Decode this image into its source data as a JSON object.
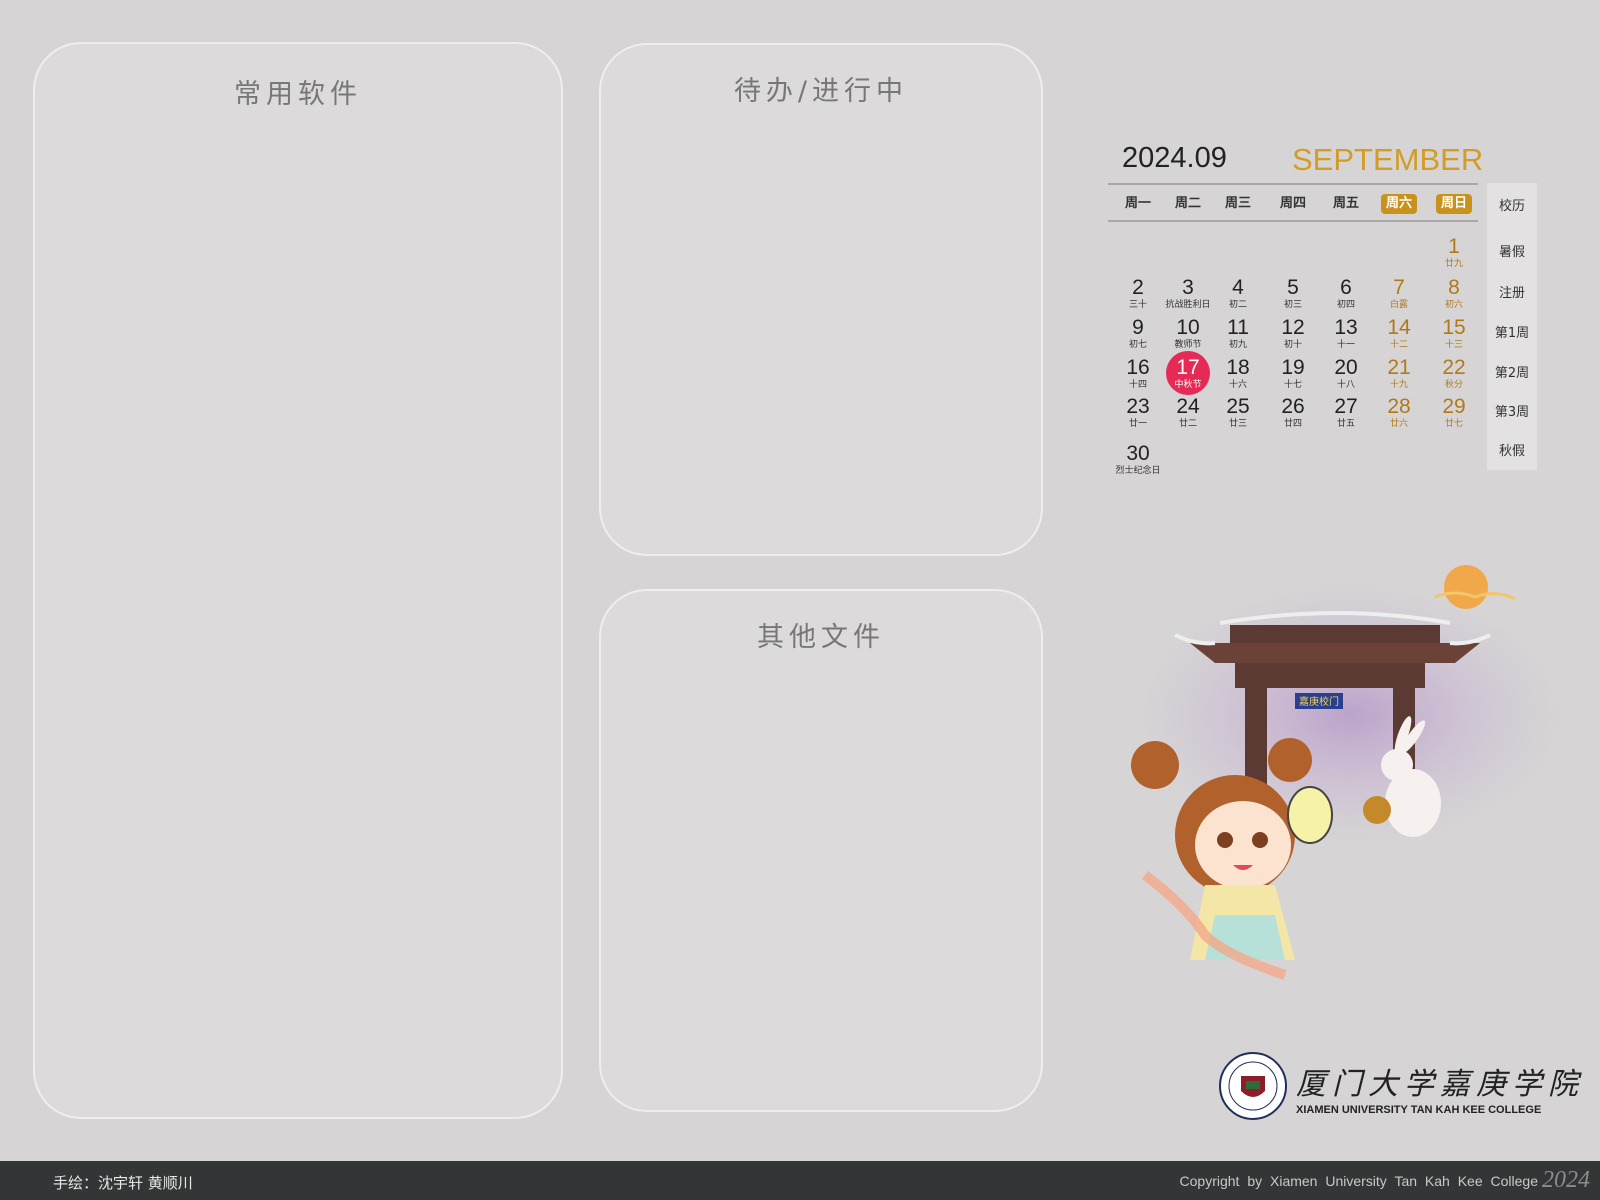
{
  "panels": {
    "software_title": "常用软件",
    "todo_title": "待办/进行中",
    "other_title": "其他文件"
  },
  "calendar": {
    "year_month": "2024.09",
    "month_name": "SEPTEMBER",
    "weekdays": [
      "周一",
      "周二",
      "周三",
      "周四",
      "周五",
      "周六",
      "周日"
    ],
    "today": 17,
    "days": [
      {
        "n": "1",
        "s": "廿九"
      },
      {
        "n": "2",
        "s": "三十"
      },
      {
        "n": "3",
        "s": "抗战胜利日"
      },
      {
        "n": "4",
        "s": "初二"
      },
      {
        "n": "5",
        "s": "初三"
      },
      {
        "n": "6",
        "s": "初四"
      },
      {
        "n": "7",
        "s": "白露"
      },
      {
        "n": "8",
        "s": "初六"
      },
      {
        "n": "9",
        "s": "初七"
      },
      {
        "n": "10",
        "s": "教师节"
      },
      {
        "n": "11",
        "s": "初九"
      },
      {
        "n": "12",
        "s": "初十"
      },
      {
        "n": "13",
        "s": "十一"
      },
      {
        "n": "14",
        "s": "十二"
      },
      {
        "n": "15",
        "s": "十三"
      },
      {
        "n": "16",
        "s": "十四"
      },
      {
        "n": "17",
        "s": "中秋节"
      },
      {
        "n": "18",
        "s": "十六"
      },
      {
        "n": "19",
        "s": "十七"
      },
      {
        "n": "20",
        "s": "十八"
      },
      {
        "n": "21",
        "s": "十九"
      },
      {
        "n": "22",
        "s": "秋分"
      },
      {
        "n": "23",
        "s": "廿一"
      },
      {
        "n": "24",
        "s": "廿二"
      },
      {
        "n": "25",
        "s": "廿三"
      },
      {
        "n": "26",
        "s": "廿四"
      },
      {
        "n": "27",
        "s": "廿五"
      },
      {
        "n": "28",
        "s": "廿六"
      },
      {
        "n": "29",
        "s": "廿七"
      },
      {
        "n": "30",
        "s": "烈士纪念日"
      }
    ],
    "side_items": [
      "校历",
      "暑假",
      "注册",
      "第1周",
      "第2周",
      "第3周",
      "秋假"
    ],
    "accent_color": "#c8921c",
    "today_color": "#e52a55"
  },
  "college": {
    "name_cn": "厦门大学嘉庚学院",
    "name_en": "XIAMEN UNIVERSITY TAN KAH KEE COLLEGE"
  },
  "gate_plaque": "嘉庚校门",
  "footer": {
    "credit": "手绘：沈宇轩 黄顺川",
    "copyright": "Copyright by Xiamen University Tan Kah Kee College",
    "year": "2024"
  }
}
